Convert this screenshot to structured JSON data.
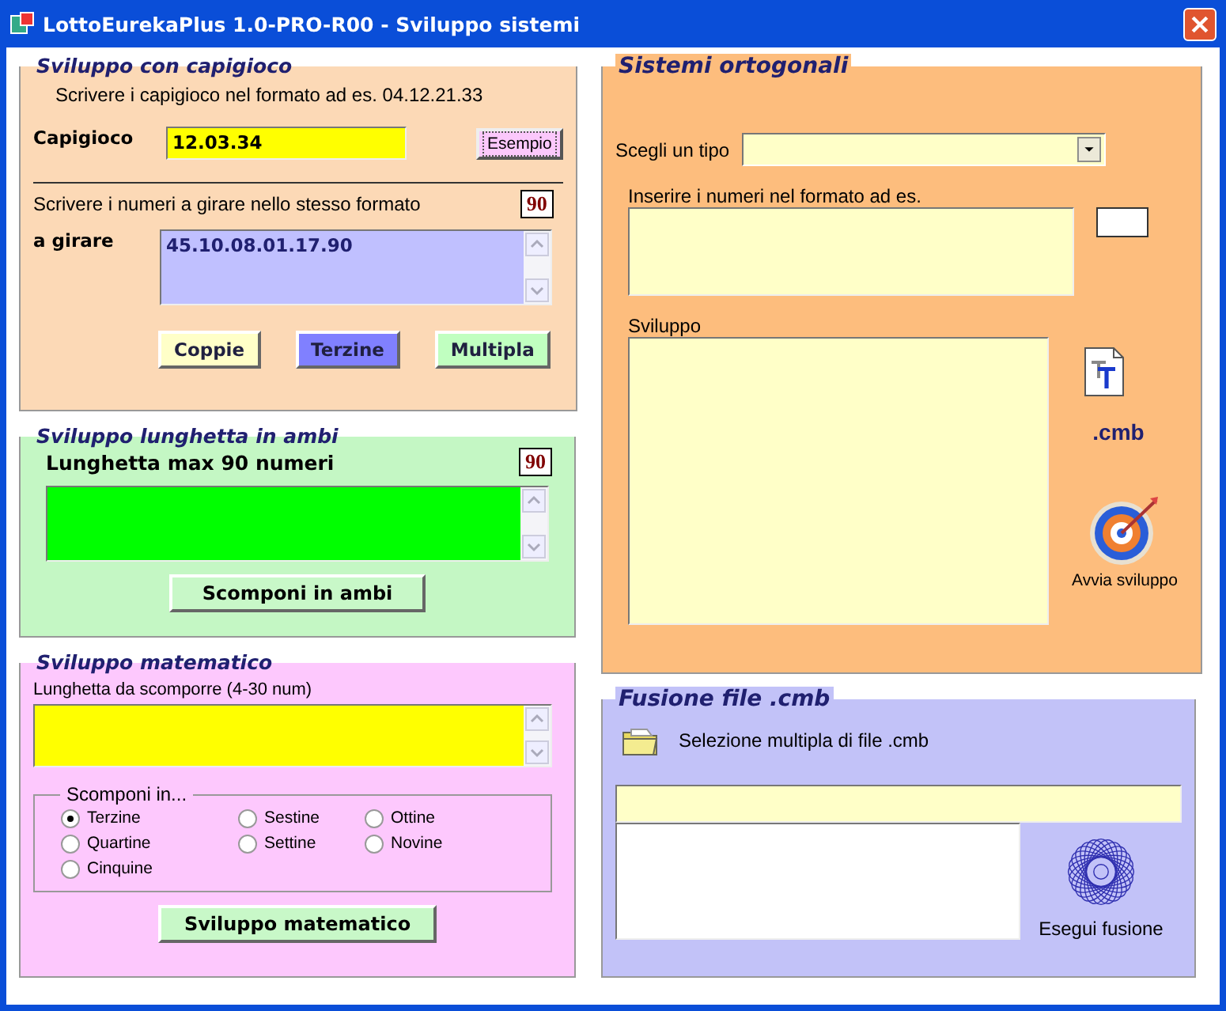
{
  "window": {
    "title": "LottoEurekaPlus 1.0-PRO-R00 - Sviluppo sistemi"
  },
  "capigioco": {
    "title": "Sviluppo con capigioco",
    "hint": "Scrivere i capigioco nel formato ad es. 04.12.21.33",
    "label": "Capigioco",
    "value": "12.03.34",
    "example_button": "Esempio",
    "hint2": "Scrivere i numeri a girare nello stesso formato",
    "count": "90",
    "girare_label": "a girare",
    "girare_value": "45.10.08.01.17.90",
    "buttons": [
      {
        "label": "Coppie",
        "color": "#ffffc8"
      },
      {
        "label": "Terzine",
        "color": "#8080ff"
      },
      {
        "label": "Multipla",
        "color": "#c0ffc0"
      }
    ]
  },
  "lunghetta": {
    "title": "Sviluppo lunghetta in ambi",
    "label": "Lunghetta max 90 numeri",
    "count": "90",
    "button": "Scomponi in ambi"
  },
  "matematico": {
    "title": "Sviluppo matematico",
    "label": "Lunghetta da scomporre (4-30 num)",
    "group": "Scomponi in...",
    "options": [
      {
        "label": "Terzine",
        "selected": true
      },
      {
        "label": "Sestine",
        "selected": false
      },
      {
        "label": "Ottine",
        "selected": false
      },
      {
        "label": "Quartine",
        "selected": false
      },
      {
        "label": "Settine",
        "selected": false
      },
      {
        "label": "Novine",
        "selected": false
      },
      {
        "label": "Cinquine",
        "selected": false
      }
    ],
    "button": "Sviluppo matematico"
  },
  "ortogonali": {
    "title": "Sistemi ortogonali",
    "type_label": "Scegli un tipo",
    "numbers_label": "Inserire i numeri nel formato ad es.",
    "sviluppo_label": "Sviluppo",
    "cmb_label": ".cmb",
    "run_label": "Avvia sviluppo"
  },
  "fusione": {
    "title": "Fusione file .cmb",
    "select_label": "Selezione multipla di file .cmb",
    "run_label": "Esegui fusione"
  }
}
